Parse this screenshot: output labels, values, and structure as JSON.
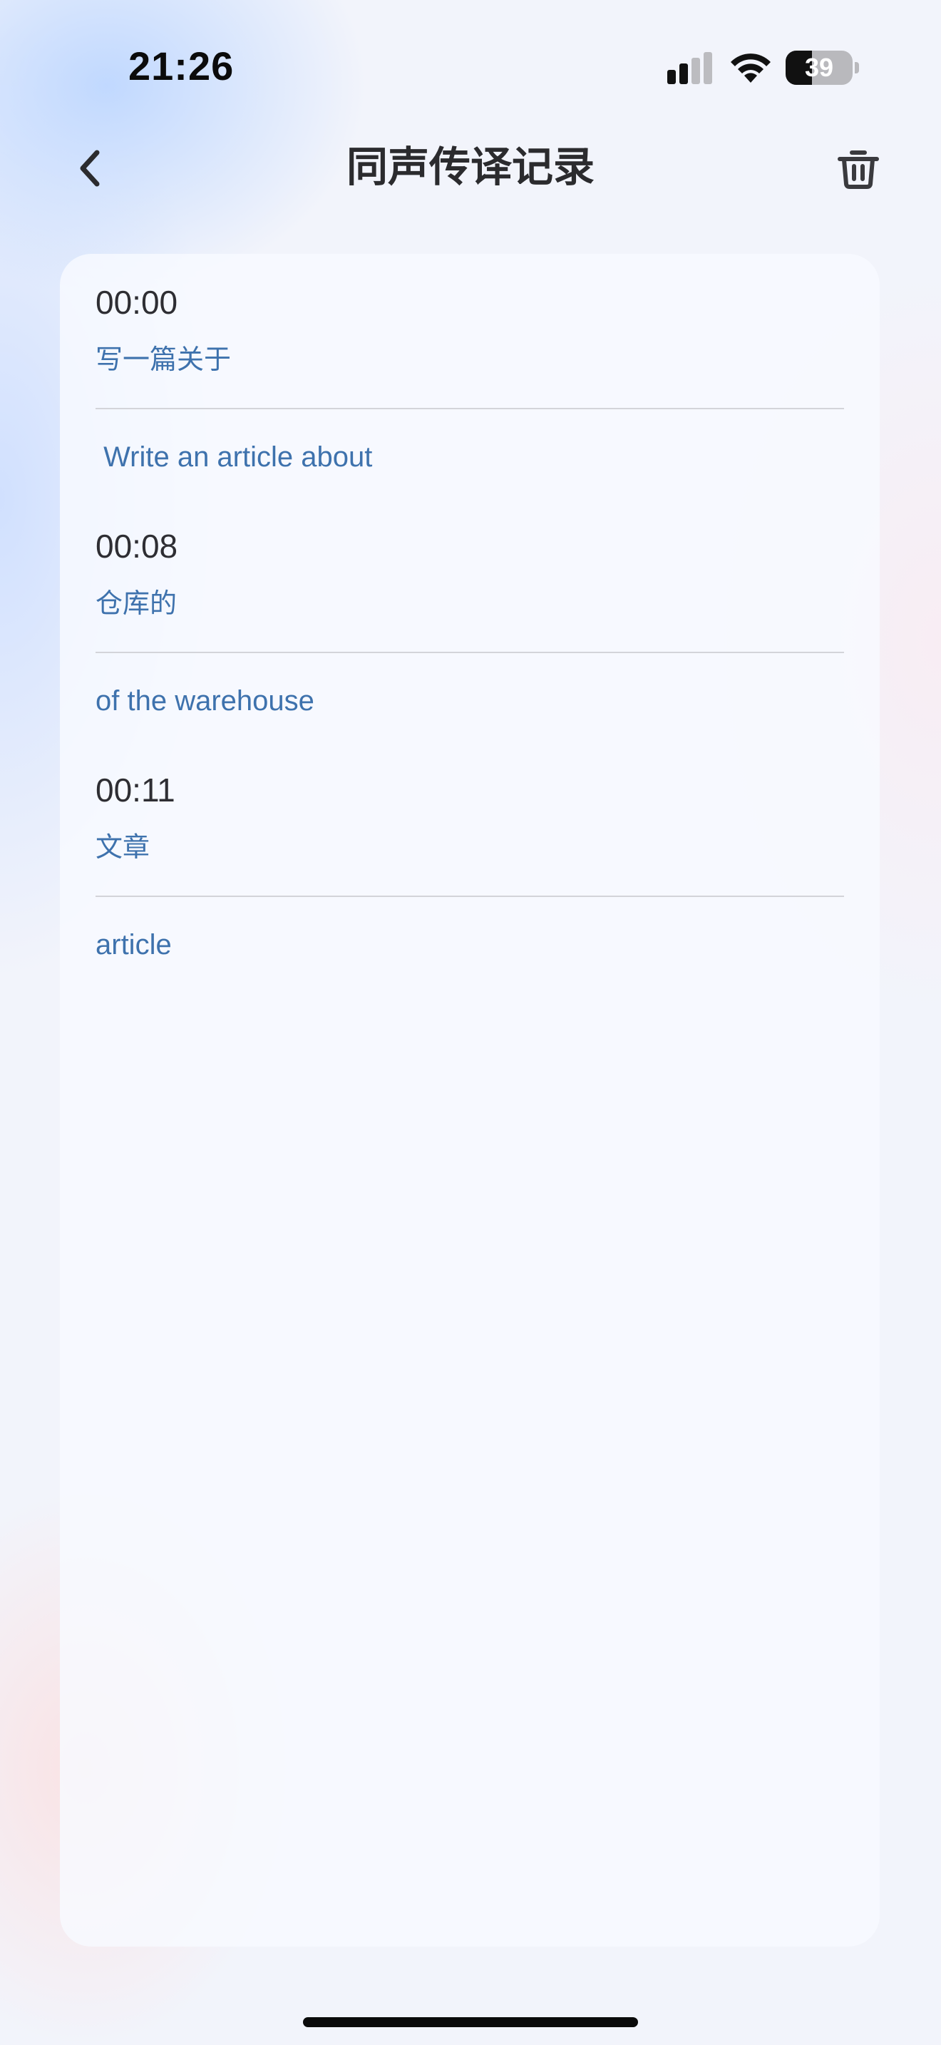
{
  "status_bar": {
    "time": "21:26",
    "battery_level": "39",
    "battery_fraction": 0.39,
    "icons": [
      "signal-icon",
      "wifi-icon",
      "battery-icon"
    ]
  },
  "header": {
    "title": "同声传译记录",
    "back_icon": "chevron-left-icon",
    "delete_icon": "trash-icon"
  },
  "records": [
    {
      "time": "00:00",
      "source": "写一篇关于",
      "target": " Write an article about"
    },
    {
      "time": "00:08",
      "source": "仓库的",
      "target": "of the warehouse"
    },
    {
      "time": "00:11",
      "source": "文章",
      "target": "article"
    }
  ],
  "colors": {
    "accent_text": "#3e72ad",
    "time_text": "#2e2e33",
    "title_text": "#2b2b2e",
    "divider": "#d3d4d9"
  }
}
